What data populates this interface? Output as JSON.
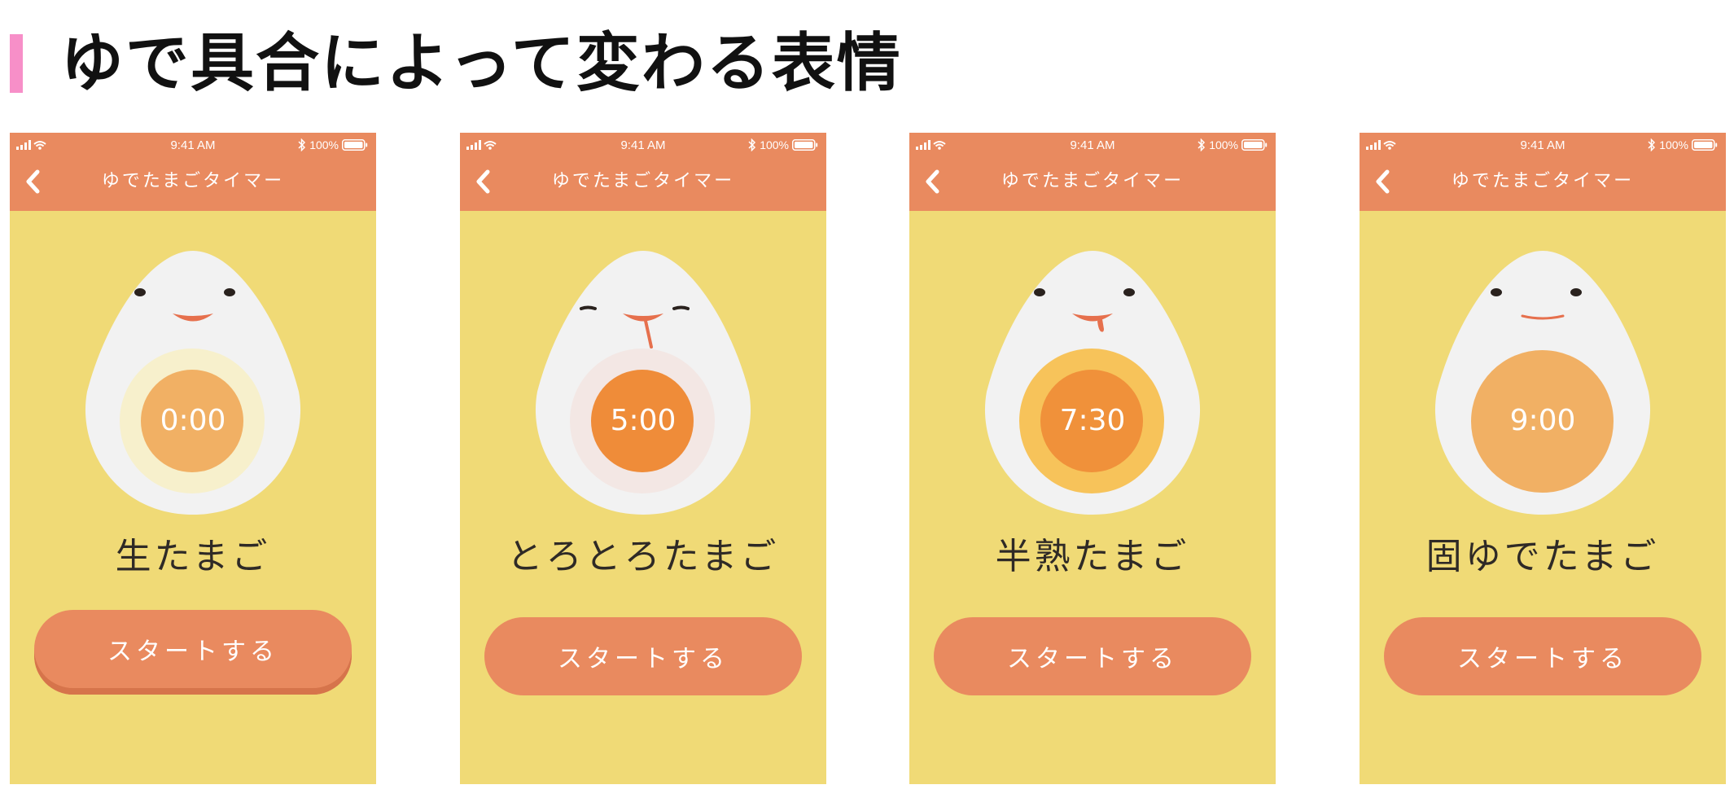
{
  "page": {
    "title": "ゆで具合によって変わる表情"
  },
  "colors": {
    "accent_bar": "#f78fc8",
    "header": "#e98a5f",
    "body": "#f0da76",
    "egg_white": "#f2f2f2",
    "button": "#e98a5f",
    "button_shadow": "#d6744b",
    "mouth": "#e6704d",
    "eye": "#2a221e"
  },
  "status_bar": {
    "time": "9:41 AM",
    "battery": "100%",
    "icons": [
      "signal-icon",
      "wifi-icon",
      "bluetooth-icon",
      "battery-icon"
    ]
  },
  "nav": {
    "title": "ゆでたまごタイマー",
    "back_icon": "chevron-left-icon"
  },
  "screens": [
    {
      "time": "0:00",
      "name": "生たまご",
      "button": "スタートする",
      "expression": "smile",
      "yolk_outer": "#f7f0cc",
      "yolk_inner": "#f1b064",
      "button_pressed": true
    },
    {
      "time": "5:00",
      "name": "とろとろたまご",
      "button": "スタートする",
      "expression": "content-drool",
      "yolk_outer": "#f3e7e4",
      "yolk_inner": "#ef8c39",
      "button_pressed": false
    },
    {
      "time": "7:30",
      "name": "半熟たまご",
      "button": "スタートする",
      "expression": "tongue",
      "yolk_outer": "#f7c35a",
      "yolk_inner": "#f0913a",
      "button_pressed": false
    },
    {
      "time": "9:00",
      "name": "固ゆでたまご",
      "button": "スタートする",
      "expression": "flat-smile",
      "yolk_outer": "#f1b064",
      "yolk_inner": "#f1b064",
      "button_pressed": false
    }
  ]
}
